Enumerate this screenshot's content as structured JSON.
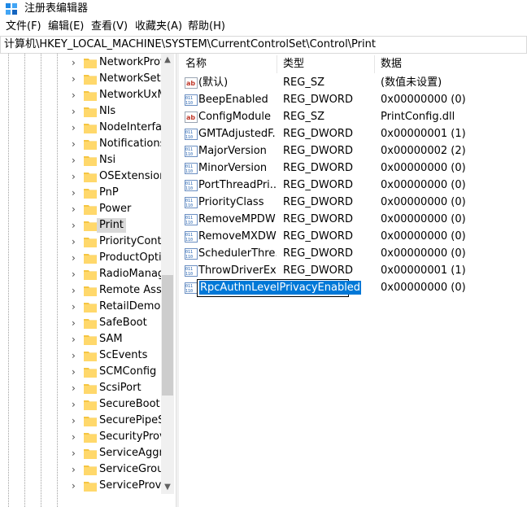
{
  "window": {
    "title": "注册表编辑器",
    "icon": "regedit-icon"
  },
  "menu": [
    "文件(F)",
    "编辑(E)",
    "查看(V)",
    "收藏夹(A)",
    "帮助(H)"
  ],
  "address": "计算机\\HKEY_LOCAL_MACHINE\\SYSTEM\\CurrentControlSet\\Control\\Print",
  "tree": {
    "items": [
      {
        "label": "NetworkProv"
      },
      {
        "label": "NetworkSetu"
      },
      {
        "label": "NetworkUxM"
      },
      {
        "label": "Nls"
      },
      {
        "label": "NodeInterfac"
      },
      {
        "label": "Notifications"
      },
      {
        "label": "Nsi"
      },
      {
        "label": "OSExtensionI"
      },
      {
        "label": "PnP"
      },
      {
        "label": "Power"
      },
      {
        "label": "Print",
        "selected": true
      },
      {
        "label": "PriorityContr"
      },
      {
        "label": "ProductOptic"
      },
      {
        "label": "RadioManag"
      },
      {
        "label": "Remote Assis"
      },
      {
        "label": "RetailDemo"
      },
      {
        "label": "SafeBoot"
      },
      {
        "label": "SAM"
      },
      {
        "label": "ScEvents"
      },
      {
        "label": "SCMConfig"
      },
      {
        "label": "ScsiPort"
      },
      {
        "label": "SecureBoot"
      },
      {
        "label": "SecurePipeSe"
      },
      {
        "label": "SecurityProvi"
      },
      {
        "label": "ServiceAggre"
      },
      {
        "label": "ServiceGroup"
      },
      {
        "label": "ServiceProvic"
      }
    ]
  },
  "list": {
    "headers": {
      "name": "名称",
      "type": "类型",
      "data": "数据"
    },
    "rows": [
      {
        "icon": "string-value-icon",
        "name": "(默认)",
        "type": "REG_SZ",
        "data": "(数值未设置)"
      },
      {
        "icon": "binary-value-icon",
        "name": "BeepEnabled",
        "type": "REG_DWORD",
        "data": "0x00000000 (0)"
      },
      {
        "icon": "string-value-icon",
        "name": "ConfigModule",
        "type": "REG_SZ",
        "data": "PrintConfig.dll"
      },
      {
        "icon": "binary-value-icon",
        "name": "GMTAdjustedF...",
        "type": "REG_DWORD",
        "data": "0x00000001 (1)"
      },
      {
        "icon": "binary-value-icon",
        "name": "MajorVersion",
        "type": "REG_DWORD",
        "data": "0x00000002 (2)"
      },
      {
        "icon": "binary-value-icon",
        "name": "MinorVersion",
        "type": "REG_DWORD",
        "data": "0x00000000 (0)"
      },
      {
        "icon": "binary-value-icon",
        "name": "PortThreadPri...",
        "type": "REG_DWORD",
        "data": "0x00000000 (0)"
      },
      {
        "icon": "binary-value-icon",
        "name": "PriorityClass",
        "type": "REG_DWORD",
        "data": "0x00000000 (0)"
      },
      {
        "icon": "binary-value-icon",
        "name": "RemoveMPDW",
        "type": "REG_DWORD",
        "data": "0x00000000 (0)"
      },
      {
        "icon": "binary-value-icon",
        "name": "RemoveMXDW",
        "type": "REG_DWORD",
        "data": "0x00000000 (0)"
      },
      {
        "icon": "binary-value-icon",
        "name": "SchedulerThre...",
        "type": "REG_DWORD",
        "data": "0x00000000 (0)"
      },
      {
        "icon": "binary-value-icon",
        "name": "ThrowDriverEx...",
        "type": "REG_DWORD",
        "data": "0x00000001 (1)"
      },
      {
        "icon": "binary-value-icon",
        "name": "RpcAuthnLevelPrivacyEnabled",
        "type": "",
        "data": "0x00000000 (0)",
        "editing": true
      }
    ]
  },
  "colors": {
    "selection": "#0078d7",
    "tree_selected": "#d9d9d9",
    "folder": "#f5c542"
  }
}
